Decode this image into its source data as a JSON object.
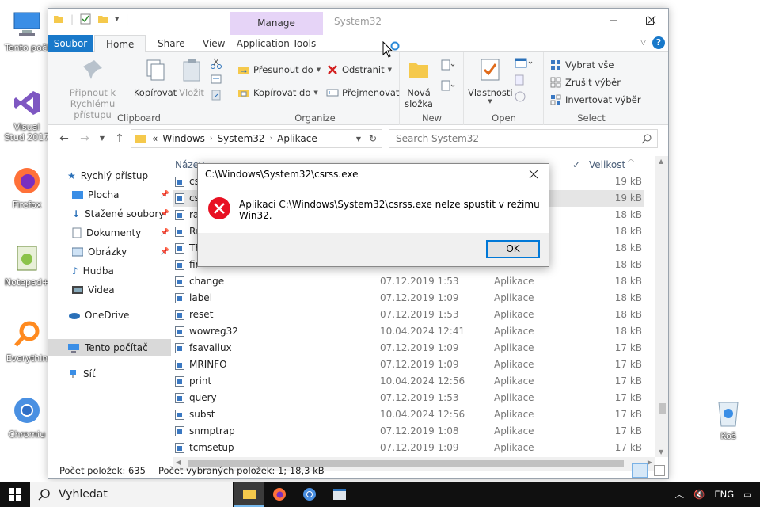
{
  "desktop": {
    "icons": [
      {
        "label": "Tento počí",
        "icon": "computer-icon"
      },
      {
        "label": "Visual Stud 2017",
        "icon": "visual-studio-icon"
      },
      {
        "label": "Firefox",
        "icon": "firefox-icon"
      },
      {
        "label": "Notepad+",
        "icon": "notepad-plus-plus-icon"
      },
      {
        "label": "Everythin",
        "icon": "everything-search-icon"
      },
      {
        "label": "Chromiu",
        "icon": "chromium-icon"
      },
      {
        "label": "Koš",
        "icon": "recycle-bin-icon"
      }
    ]
  },
  "explorer": {
    "title": "System32",
    "contextual_tab_header": "Manage",
    "tabs": {
      "file": "Soubor",
      "home": "Home",
      "share": "Share",
      "view": "View",
      "app_tools": "Application Tools"
    },
    "ribbon": {
      "clipboard": {
        "pin_label": "Připnout k Rychlému přístupu",
        "copy_label": "Kopírovat",
        "paste_label": "Vložit",
        "group_label": "Clipboard"
      },
      "organize": {
        "move_label": "Přesunout do",
        "copy_to_label": "Kopírovat do",
        "delete_label": "Odstranit",
        "rename_label": "Přejmenovat",
        "group_label": "Organize"
      },
      "new": {
        "new_folder_label": "Nová složka",
        "group_label": "New"
      },
      "open": {
        "properties_label": "Vlastnosti",
        "group_label": "Open"
      },
      "select": {
        "select_all_label": "Vybrat vše",
        "select_none_label": "Zrušit výběr",
        "invert_label": "Invertovat výběr",
        "group_label": "Select"
      }
    },
    "address": {
      "prefix": "«",
      "parts": [
        "Windows",
        "System32",
        "Aplikace"
      ]
    },
    "search": {
      "placeholder": "Search System32"
    },
    "nav": {
      "quick_access": "Rychlý přístup",
      "desktop": "Plocha",
      "downloads": "Stažené soubory",
      "documents": "Dokumenty",
      "pictures": "Obrázky",
      "music": "Hudba",
      "videos": "Videa",
      "onedrive": "OneDrive",
      "this_pc": "Tento počítač",
      "network": "Síť"
    },
    "columns": {
      "name": "Název",
      "size": "Velikost"
    },
    "rows": [
      {
        "name": "cs",
        "date": "",
        "type": "",
        "size": "19 kB"
      },
      {
        "name": "cs",
        "date": "",
        "type": "",
        "size": "19 kB"
      },
      {
        "name": "ra",
        "date": "",
        "type": "",
        "size": "18 kB"
      },
      {
        "name": "Rr",
        "date": "",
        "type": "",
        "size": "18 kB"
      },
      {
        "name": "TF",
        "date": "",
        "type": "",
        "size": "18 kB"
      },
      {
        "name": "fir",
        "date": "",
        "type": "",
        "size": "18 kB"
      },
      {
        "name": "change",
        "date": "07.12.2019 1:53",
        "type": "Aplikace",
        "size": "18 kB"
      },
      {
        "name": "label",
        "date": "07.12.2019 1:09",
        "type": "Aplikace",
        "size": "18 kB"
      },
      {
        "name": "reset",
        "date": "07.12.2019 1:53",
        "type": "Aplikace",
        "size": "18 kB"
      },
      {
        "name": "wowreg32",
        "date": "10.04.2024 12:41",
        "type": "Aplikace",
        "size": "18 kB"
      },
      {
        "name": "fsavailux",
        "date": "07.12.2019 1:09",
        "type": "Aplikace",
        "size": "17 kB"
      },
      {
        "name": "MRINFO",
        "date": "07.12.2019 1:09",
        "type": "Aplikace",
        "size": "17 kB"
      },
      {
        "name": "print",
        "date": "10.04.2024 12:56",
        "type": "Aplikace",
        "size": "17 kB"
      },
      {
        "name": "query",
        "date": "07.12.2019 1:53",
        "type": "Aplikace",
        "size": "17 kB"
      },
      {
        "name": "subst",
        "date": "10.04.2024 12:56",
        "type": "Aplikace",
        "size": "17 kB"
      },
      {
        "name": "snmptrap",
        "date": "07.12.2019 1:08",
        "type": "Aplikace",
        "size": "17 kB"
      },
      {
        "name": "tcmsetup",
        "date": "07.12.2019 1:09",
        "type": "Aplikace",
        "size": "17 kB"
      }
    ],
    "status": {
      "count": "Počet položek: 635",
      "selected": "Počet vybraných položek: 1; 18,3 kB"
    }
  },
  "dialog": {
    "title": "C:\\Windows\\System32\\csrss.exe",
    "message": "Aplikaci C:\\Windows\\System32\\csrss.exe nelze spustit v režimu Win32.",
    "ok_label": "OK"
  },
  "taskbar": {
    "search_placeholder": "Vyhledat",
    "language": "ENG"
  },
  "colors": {
    "accent": "#1979ca",
    "manage_tab": "#e6d4f7",
    "error": "#e81123"
  }
}
